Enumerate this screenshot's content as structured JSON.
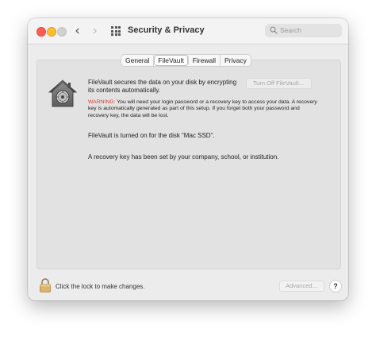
{
  "window": {
    "title": "Security & Privacy",
    "back_glyph": "‹",
    "forward_glyph": "›"
  },
  "search": {
    "placeholder": "Search",
    "icon": "magnifying-glass-icon"
  },
  "tabs": [
    {
      "label": "General",
      "active": false
    },
    {
      "label": "FileVault",
      "active": true
    },
    {
      "label": "Firewall",
      "active": false
    },
    {
      "label": "Privacy",
      "active": false
    }
  ],
  "filevault": {
    "description": "FileVault secures the data on your disk by encrypting its contents automatically.",
    "turn_off_button": "Turn Off FileVault…",
    "warning_label": "WARNING:",
    "warning_text": " You will need your login password or a recovery key to access your data. A recovery key is automatically generated as part of this setup. If you forget both your password and recovery key, the data will be lost.",
    "disk_status": "FileVault is turned on for the disk “Mac SSD”.",
    "recovery_status": "A recovery key has been set by your company, school, or institution.",
    "icon": "filevault-house-icon"
  },
  "footer": {
    "lock_text": "Click the lock to make changes.",
    "advanced_button": "Advanced…",
    "help_button": "?",
    "lock_icon": "lock-icon"
  },
  "colors": {
    "warning": "#d83a2e",
    "close": "#fd5f57",
    "minimize": "#febc2e",
    "zoom_disabled": "#d1d1d1"
  }
}
